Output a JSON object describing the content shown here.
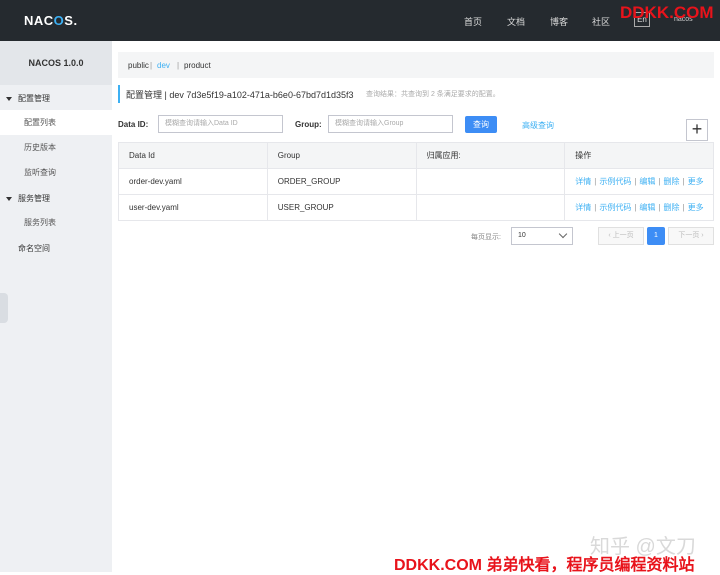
{
  "header": {
    "logo": "NACOS.",
    "nav": [
      "首页",
      "文档",
      "博客",
      "社区"
    ],
    "lang": "En",
    "user": "nacos"
  },
  "sidebar": {
    "title": "NACOS 1.0.0",
    "groups": [
      {
        "label": "配置管理",
        "items": [
          "配置列表",
          "历史版本",
          "监听查询"
        ]
      },
      {
        "label": "服务管理",
        "items": [
          "服务列表"
        ]
      }
    ],
    "namespace": "命名空间"
  },
  "namespaces": {
    "public": "public",
    "dev": "dev",
    "product": "product"
  },
  "title": {
    "text": "配置管理  |  dev  7d3e5f19-a102-471a-b6e0-67bd7d1d35f3",
    "hint": "查询结果：共查询到 2 条满足要求的配置。"
  },
  "search": {
    "dataid_label": "Data ID:",
    "dataid_placeholder": "模糊查询请输入Data ID",
    "group_label": "Group:",
    "group_placeholder": "模糊查询请输入Group",
    "query_button": "查询",
    "advanced_link": "高级查询",
    "add_button": "+"
  },
  "table": {
    "headers": [
      "Data Id",
      "Group",
      "归属应用:",
      "操作"
    ],
    "rows": [
      {
        "data_id": "order-dev.yaml",
        "group": "ORDER_GROUP",
        "app": ""
      },
      {
        "data_id": "user-dev.yaml",
        "group": "USER_GROUP",
        "app": ""
      }
    ],
    "actions": {
      "detail": "详情",
      "sample": "示例代码",
      "edit": "编辑",
      "delete": "删除",
      "more": "更多"
    }
  },
  "pagination": {
    "page_size_label": "每页显示:",
    "page_size": "10",
    "prev": "上一页",
    "current_page": "1",
    "next": "下一页"
  },
  "watermarks": {
    "top": "DDKK.COM",
    "zhihu": "知乎 @文刀",
    "bottom": "DDKK.COM 弟弟快看，程序员编程资料站"
  }
}
